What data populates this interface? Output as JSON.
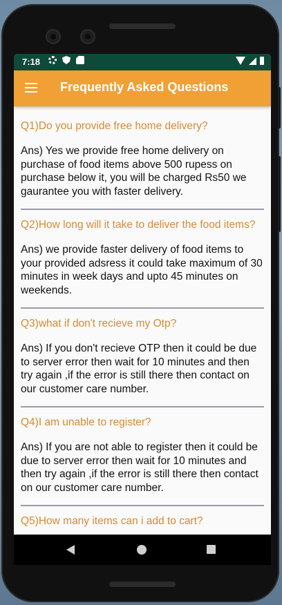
{
  "status_bar": {
    "time": "7:18"
  },
  "app_bar": {
    "title": "Frequently Asked Questions"
  },
  "faqs": [
    {
      "question": "Q1)Do you provide free home delivery?",
      "answer": "Ans) Yes we provide free home delivery on purchase of food items above 500 rupess on purchase below it, you will be charged Rs50 we gaurantee you with faster delivery."
    },
    {
      "question": "Q2)How long will it take to deliver the food items?",
      "answer": "Ans) we provide faster delivery of food items to your provided adsress it could take maximum of 30 minutes in week days and upto 45 minutes on weekends."
    },
    {
      "question": "Q3)what if don't recieve my Otp?",
      "answer": "Ans) If you don't recieve OTP then it could be due to server error then wait for 10 minutes and then try again ,if the error is still there then contact on our customer care number."
    },
    {
      "question": "Q4)I am unable to register?",
      "answer": "Ans) If you are not able to register then it could be due to server error then wait for 10 minutes and then try again ,if the error is still there then contact on our customer care number."
    },
    {
      "question": "Q5)How many items can i add to cart?",
      "answer": ""
    }
  ],
  "colors": {
    "status_bar": "#0e4a3a",
    "app_bar": "#f0a035",
    "question_text": "#d88a31",
    "divider": "#9a9aa8"
  },
  "icons": [
    "menu-icon",
    "settings-icon",
    "shield-icon",
    "sim-card-icon",
    "wifi-icon",
    "signal-icon",
    "battery-icon",
    "back-icon",
    "home-icon",
    "recents-icon"
  ]
}
